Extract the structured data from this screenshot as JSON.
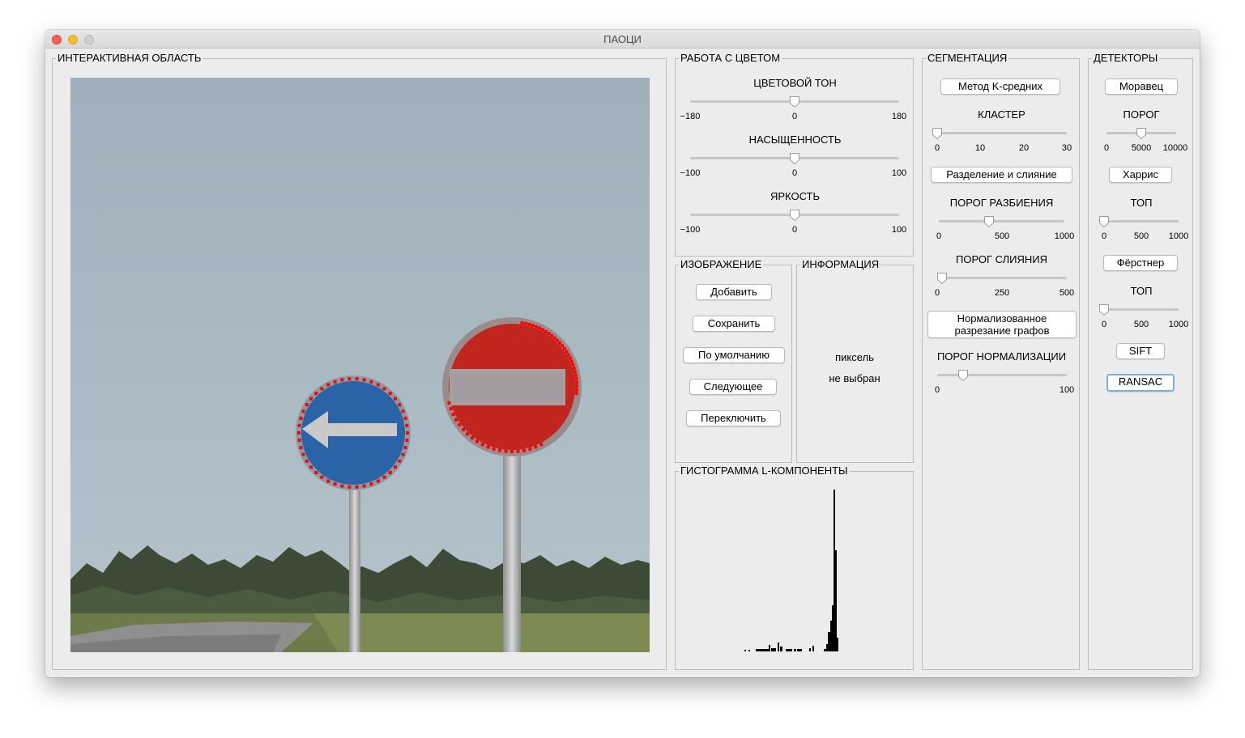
{
  "window": {
    "title": "ПАОЦИ"
  },
  "interactive": {
    "title": "ИНТЕРАКТИВНАЯ ОБЛАСТЬ"
  },
  "color": {
    "title": "РАБОТА С ЦВЕТОМ",
    "hue": {
      "label": "ЦВЕТОВОЙ ТОН",
      "min": "−180",
      "mid": "0",
      "max": "180",
      "value": 0
    },
    "saturation": {
      "label": "НАСЫЩЕННОСТЬ",
      "min": "−100",
      "mid": "0",
      "max": "100",
      "value": 0
    },
    "brightness": {
      "label": "ЯРКОСТЬ",
      "min": "−100",
      "mid": "0",
      "max": "100",
      "value": 0
    }
  },
  "image": {
    "title": "ИЗОБРАЖЕНИЕ",
    "add": "Добавить",
    "save": "Сохранить",
    "default": "По умолчанию",
    "next": "Следующее",
    "toggle": "Переключить"
  },
  "info": {
    "title": "ИНФОРМАЦИЯ",
    "line1": "пиксель",
    "line2": "не выбран"
  },
  "histogram": {
    "title": "ГИСТОГРАММА L-КОМПОНЕНТЫ"
  },
  "segmentation": {
    "title": "СЕГМЕНТАЦИЯ",
    "kmeans": "Метод K-средних",
    "cluster": {
      "label": "КЛАСТЕР",
      "t0": "0",
      "t1": "10",
      "t2": "20",
      "t3": "30",
      "value": 0
    },
    "split_merge": "Разделение и слияние",
    "split_threshold": {
      "label": "ПОРОГ РАЗБИЕНИЯ",
      "min": "0",
      "mid": "500",
      "max": "1000",
      "value": 400
    },
    "merge_threshold": {
      "label": "ПОРОГ СЛИЯНИЯ",
      "min": "0",
      "mid": "250",
      "max": "500",
      "value": 20
    },
    "normcut_line1": "Нормализованное",
    "normcut_line2": "разрезание графов",
    "norm_threshold": {
      "label": "ПОРОГ НОРМАЛИЗАЦИИ",
      "min": "0",
      "max": "100",
      "value": 20
    }
  },
  "detectors": {
    "title": "ДЕТЕКТОРЫ",
    "moravec": "Моравец",
    "threshold": {
      "label": "ПОРОГ",
      "min": "0",
      "mid": "5000",
      "max": "10000",
      "value": 5000
    },
    "harris": "Харрис",
    "top1": {
      "label": "ТОП",
      "min": "0",
      "mid": "500",
      "max": "1000",
      "value": 0
    },
    "forstner": "Фёрстнер",
    "top2": {
      "label": "ТОП",
      "min": "0",
      "mid": "500",
      "max": "1000",
      "value": 0
    },
    "sift": "SIFT",
    "ransac": "RANSAC"
  },
  "colors": {
    "sky": "#a6b6bf",
    "blue_sign": "#2a63a6",
    "red_sign": "#c0261e",
    "keypoint": "#ff0000",
    "focus_ring": "#7aaee8"
  }
}
